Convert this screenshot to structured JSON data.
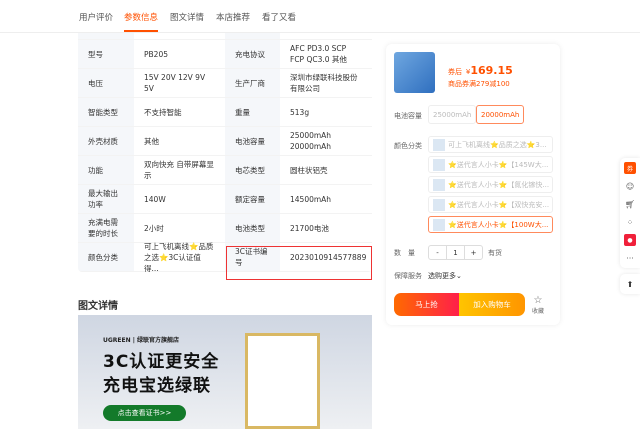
{
  "tabs": [
    "用户评价",
    "参数信息",
    "图文详情",
    "本店推荐",
    "看了又看"
  ],
  "params": [
    [
      "型号",
      "PB205",
      "充电协议",
      "AFC PD3.0 SCP FCP QC3.0 其他"
    ],
    [
      "电压",
      "15V 20V 12V 9V 5V",
      "生产厂商",
      "深圳市绿联科技股份有限公司"
    ],
    [
      "智能类型",
      "不支持智能",
      "重量",
      "513g"
    ],
    [
      "外壳材质",
      "其他",
      "电池容量",
      "25000mAh 20000mAh"
    ],
    [
      "功能",
      "双向快充 自带屏幕显示",
      "电芯类型",
      "圆柱状铝壳"
    ],
    [
      "最大输出功率",
      "140W",
      "额定容量",
      "14500mAh"
    ],
    [
      "充满电需要的时长",
      "2小时",
      "电池类型",
      "21700电池"
    ],
    [
      "颜色分类",
      "可上飞机离线⭐品质之选⭐3C认证值得...",
      "3C证书编号",
      "2023010914577889"
    ]
  ],
  "detail": {
    "title": "图文详情",
    "brand": "UGREEN | 绿联官方旗舰店",
    "line1": "3C认证更安全",
    "line2": "充电宝选绿联",
    "button": "点击查看证书>>"
  },
  "card": {
    "price_prefix": "券后",
    "currency": "¥",
    "price": "169.15",
    "coupon": "商品券满279减100",
    "capacity_label": "电池容量",
    "capacities": [
      "25000mAh",
      "20000mAh"
    ],
    "color_label": "颜色分类",
    "colors": [
      "可上飞机离线⭐品质之选⭐3...",
      "⭐送代言人小卡⭐【145W大...",
      "⭐送代言人小卡⭐【氮化镓快...",
      "⭐送代言人小卡⭐【双快充安...",
      "⭐送代言人小卡⭐【100W大..."
    ],
    "qty_label": "数　量",
    "minus": "-",
    "qty": "1",
    "plus": "+",
    "stock": "有货",
    "service_label": "保障服务",
    "service_value": "选购更多⌄",
    "buy": "马上抢",
    "cart": "加入购物车",
    "fav": "收藏"
  },
  "sidebar": {
    "coupon": "券",
    "more": "···",
    "top": "⬆"
  }
}
